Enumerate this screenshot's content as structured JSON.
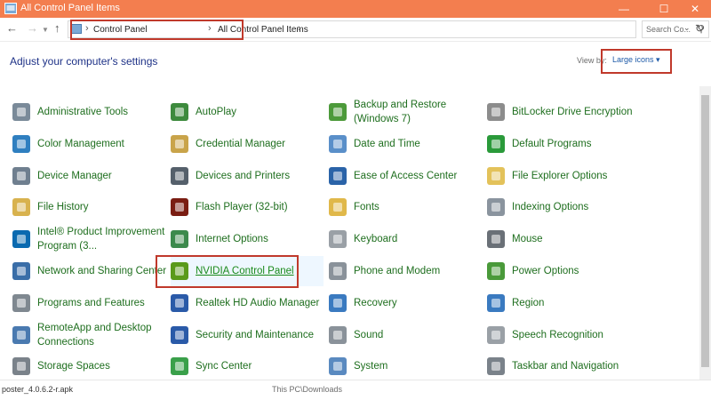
{
  "window": {
    "title": "All Control Panel Items",
    "accent_color": "#f37e4f"
  },
  "address": {
    "crumbs": [
      "Control Panel",
      "All Control Panel Items"
    ],
    "search_placeholder": "Search Co..."
  },
  "header": {
    "heading": "Adjust your computer's settings",
    "view_by_label": "View by:",
    "view_by_value": "Large icons ▾"
  },
  "items": [
    {
      "label": "Administrative Tools",
      "icon": "admin-tools-icon",
      "color": "#7a8a99"
    },
    {
      "label": "AutoPlay",
      "icon": "autoplay-icon",
      "color": "#3d8a3d"
    },
    {
      "label": "Backup and Restore (Windows 7)",
      "icon": "backup-restore-icon",
      "color": "#4c9a3a"
    },
    {
      "label": "BitLocker Drive Encryption",
      "icon": "bitlocker-icon",
      "color": "#8c8c8c"
    },
    {
      "label": "Color Management",
      "icon": "color-management-icon",
      "color": "#2f7fc0"
    },
    {
      "label": "Credential Manager",
      "icon": "credential-manager-icon",
      "color": "#c9a44a"
    },
    {
      "label": "Date and Time",
      "icon": "date-time-icon",
      "color": "#5a8fc9"
    },
    {
      "label": "Default Programs",
      "icon": "default-programs-icon",
      "color": "#2a9a3a"
    },
    {
      "label": "Device Manager",
      "icon": "device-manager-icon",
      "color": "#6f7f8f"
    },
    {
      "label": "Devices and Printers",
      "icon": "devices-printers-icon",
      "color": "#55606b"
    },
    {
      "label": "Ease of Access Center",
      "icon": "ease-of-access-icon",
      "color": "#2a63a8"
    },
    {
      "label": "File Explorer Options",
      "icon": "file-explorer-options-icon",
      "color": "#e3c25a"
    },
    {
      "label": "File History",
      "icon": "file-history-icon",
      "color": "#d8b24e"
    },
    {
      "label": "Flash Player (32-bit)",
      "icon": "flash-player-icon",
      "color": "#7a1d12"
    },
    {
      "label": "Fonts",
      "icon": "fonts-icon",
      "color": "#e0b84a"
    },
    {
      "label": "Indexing Options",
      "icon": "indexing-options-icon",
      "color": "#8a949e"
    },
    {
      "label": "Intel® Product Improvement Program (3...",
      "icon": "intel-icon",
      "color": "#0a6ab0"
    },
    {
      "label": "Internet Options",
      "icon": "internet-options-icon",
      "color": "#3c8a4c"
    },
    {
      "label": "Keyboard",
      "icon": "keyboard-icon",
      "color": "#9aa0a6"
    },
    {
      "label": "Mouse",
      "icon": "mouse-icon",
      "color": "#6a7077"
    },
    {
      "label": "Network and Sharing Center",
      "icon": "network-sharing-icon",
      "color": "#3a6ea8"
    },
    {
      "label": "NVIDIA Control Panel",
      "icon": "nvidia-icon",
      "color": "#5a9a1a",
      "selected": true
    },
    {
      "label": "Phone and Modem",
      "icon": "phone-modem-icon",
      "color": "#8a929a"
    },
    {
      "label": "Power Options",
      "icon": "power-options-icon",
      "color": "#4a9a3a"
    },
    {
      "label": "Programs and Features",
      "icon": "programs-features-icon",
      "color": "#7f8890"
    },
    {
      "label": "Realtek HD Audio Manager",
      "icon": "realtek-audio-icon",
      "color": "#2a5aa8"
    },
    {
      "label": "Recovery",
      "icon": "recovery-icon",
      "color": "#3a7ac0"
    },
    {
      "label": "Region",
      "icon": "region-icon",
      "color": "#3a7ac0"
    },
    {
      "label": "RemoteApp and Desktop Connections",
      "icon": "remoteapp-icon",
      "color": "#4a7ab0"
    },
    {
      "label": "Security and Maintenance",
      "icon": "security-maintenance-icon",
      "color": "#2a5aa8"
    },
    {
      "label": "Sound",
      "icon": "sound-icon",
      "color": "#8a929a"
    },
    {
      "label": "Speech Recognition",
      "icon": "speech-recognition-icon",
      "color": "#9aa0a6"
    },
    {
      "label": "Storage Spaces",
      "icon": "storage-spaces-icon",
      "color": "#7a828a"
    },
    {
      "label": "Sync Center",
      "icon": "sync-center-icon",
      "color": "#3aa04a"
    },
    {
      "label": "System",
      "icon": "system-icon",
      "color": "#5a8ac0"
    },
    {
      "label": "Taskbar and Navigation",
      "icon": "taskbar-navigation-icon",
      "color": "#7a828a"
    }
  ],
  "download_bar": {
    "file": "poster_4.0.6.2-r.apk",
    "location": "This PC\\Downloads"
  }
}
